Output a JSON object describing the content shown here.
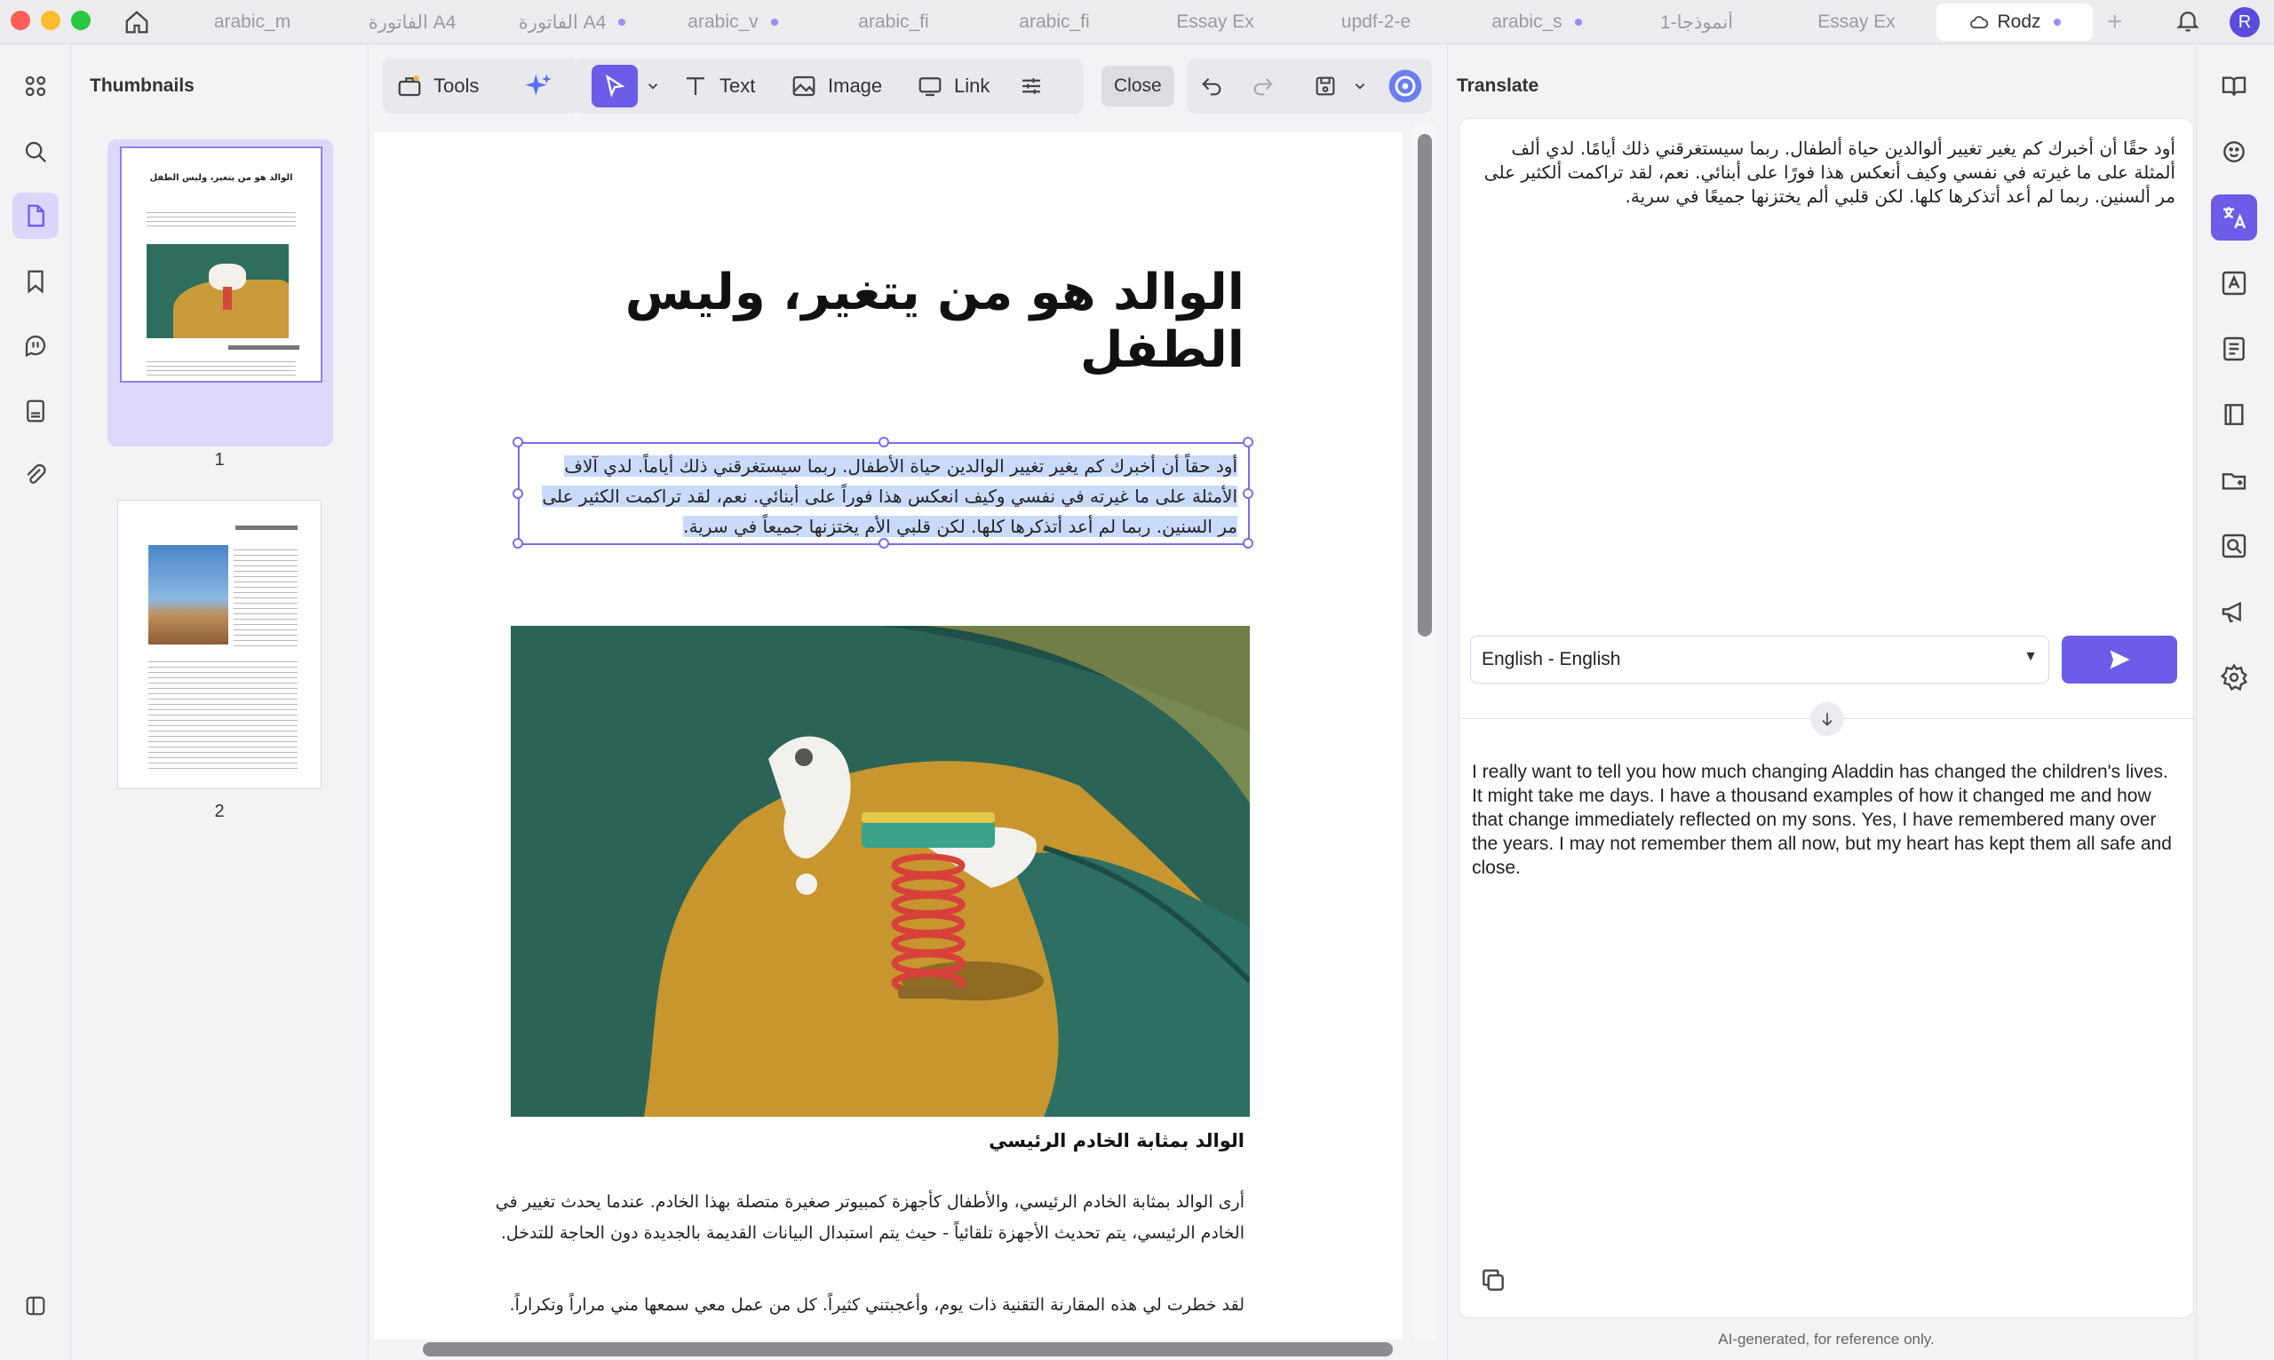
{
  "tabs": [
    {
      "label": "arabic_m",
      "dot": false,
      "active": false
    },
    {
      "label": "الفاتورة A4",
      "dot": false,
      "active": false
    },
    {
      "label": "الفاتورة A4",
      "dot": true,
      "active": false
    },
    {
      "label": "arabic_v",
      "dot": true,
      "active": false
    },
    {
      "label": "arabic_fi",
      "dot": false,
      "active": false
    },
    {
      "label": "arabic_fi",
      "dot": false,
      "active": false
    },
    {
      "label": "Essay Ex",
      "dot": false,
      "active": false
    },
    {
      "label": "updf-2-e",
      "dot": false,
      "active": false
    },
    {
      "label": "arabic_s",
      "dot": true,
      "active": false
    },
    {
      "label": "أنموذجا-1",
      "dot": false,
      "active": false
    },
    {
      "label": "Essay Ex",
      "dot": false,
      "active": false
    },
    {
      "label": "Rodz",
      "dot": true,
      "active": true
    }
  ],
  "user_initial": "R",
  "thumbnails": {
    "title": "Thumbnails",
    "pages": [
      {
        "number": "1",
        "selected": true,
        "mini_title": "الوالد هو من يتغير، وليس الطفل"
      },
      {
        "number": "2",
        "selected": false,
        "mini_title": ""
      }
    ]
  },
  "toolbar": {
    "tools": "Tools",
    "text": "Text",
    "image": "Image",
    "link": "Link",
    "close": "Close"
  },
  "document": {
    "title": "الوالد هو من يتغير، وليس الطفل",
    "selected_paragraph": "أود حقاً أن أخبرك كم يغير تغيير الوالدين حياة الأطفال. ربما سيستغرقني ذلك أياماً. لدي آلاف الأمثلة على ما غيرته في نفسي وكيف انعكس هذا فوراً على أبنائي. نعم، لقد تراكمت الكثير على مر السنين. ربما لم أعد أتذكرها كلها. لكن قلبي الأم يختزنها جميعاً في سرية.",
    "subheading": "الوالد بمثابة الخادم الرئيسي",
    "para1": "أرى الوالد بمثابة الخادم الرئيسي، والأطفال كأجهزة كمبيوتر صغيرة متصلة بهذا الخادم. عندما يحدث تغيير في الخادم الرئيسي، يتم تحديث الأجهزة تلقائياً - حيث يتم استبدال البيانات القديمة بالجديدة دون الحاجة للتدخل.",
    "para2": "لقد خطرت لي هذه المقارنة التقنية ذات يوم، وأعجبتني كثيراً. كل من عمل معي سمعها مني مراراً وتكراراً."
  },
  "translate": {
    "title": "Translate",
    "source": "أود حقًا أن أخبرك كم يغير تغيير ألوالدين حياة ألطفال. ربما سيستغرقني ذلك أيامًا. لدي ألف ألمثلة على ما غيرته في نفسي وكيف أنعكس هذا فورًا على أبنائي. نعم، لقد تراكمت ألكثير على مر ألسنين. ربما لم أعد أتذكرها كلها. لكن قلبي ألم يختزنها جميعًا في سرية.",
    "language": "English - English",
    "output": "I really want to tell you how much changing Aladdin has changed the children's lives. It might take me days. I have a thousand examples of how it changed me and how that change immediately reflected on my sons. Yes, I have remembered many over the years. I may not remember them all now, but my heart has kept them all safe and close.",
    "footer": "AI-generated, for reference only."
  },
  "colors": {
    "accent": "#6c5ce7",
    "selection": "#c9dafb",
    "close_red": "#ff5f57",
    "min_yellow": "#febc2e",
    "max_green": "#28c840"
  }
}
